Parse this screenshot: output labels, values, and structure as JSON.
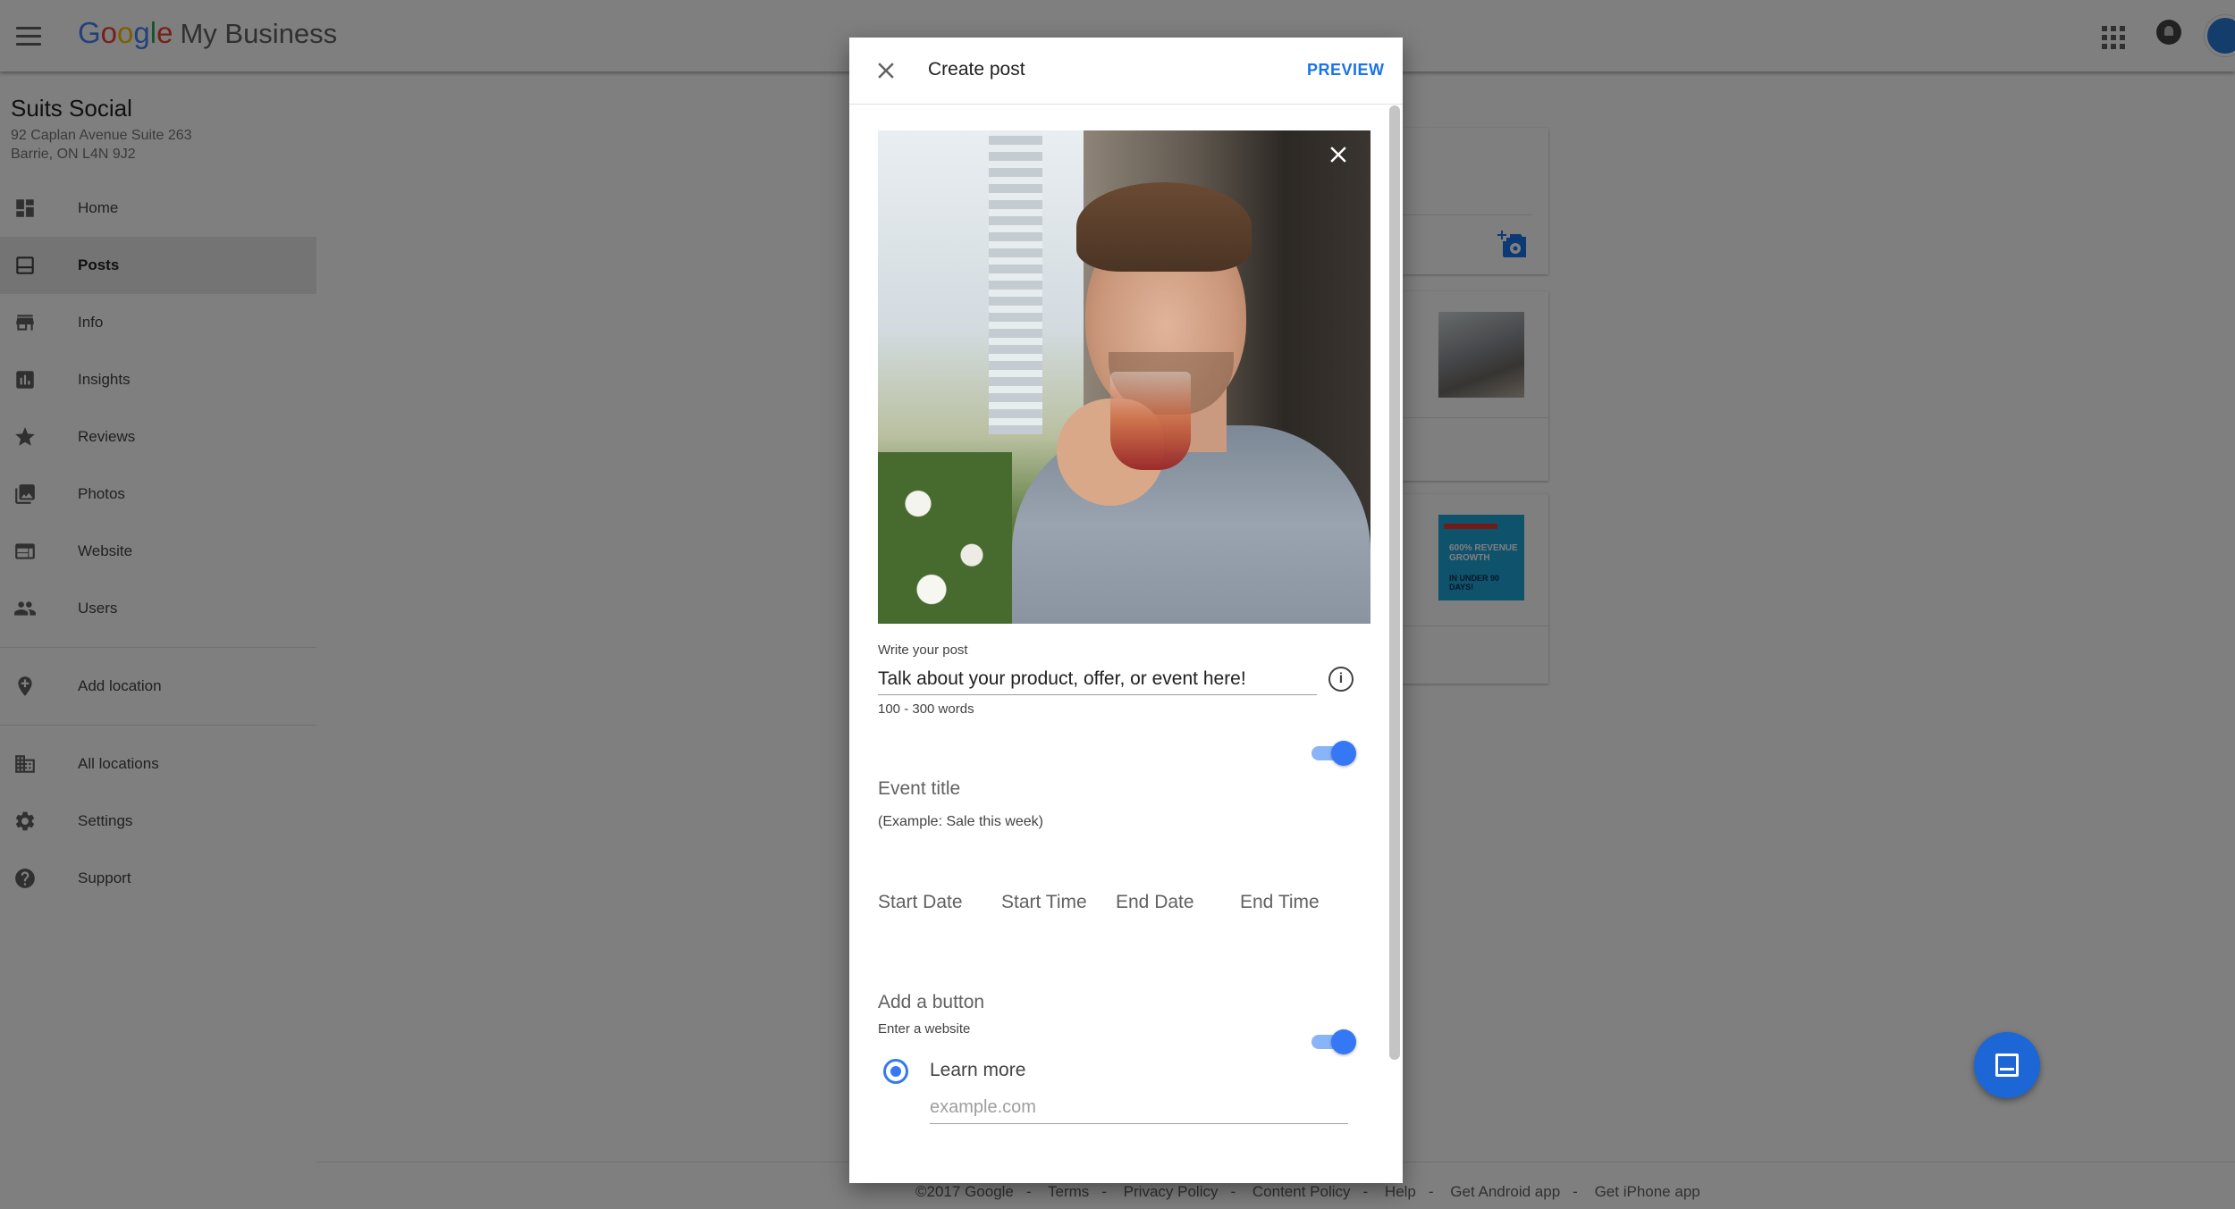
{
  "app": {
    "brand_google": "Google",
    "brand_product": "My Business"
  },
  "business": {
    "name": "Suits Social",
    "address_line1": "92 Caplan Avenue Suite 263",
    "address_line2": "Barrie, ON L4N 9J2"
  },
  "sidebar": {
    "items": [
      {
        "label": "Home",
        "icon": "dashboard-icon"
      },
      {
        "label": "Posts",
        "icon": "posts-icon",
        "active": true
      },
      {
        "label": "Info",
        "icon": "storefront-icon"
      },
      {
        "label": "Insights",
        "icon": "bar-chart-icon"
      },
      {
        "label": "Reviews",
        "icon": "star-icon"
      },
      {
        "label": "Photos",
        "icon": "photos-icon"
      },
      {
        "label": "Website",
        "icon": "website-icon"
      },
      {
        "label": "Users",
        "icon": "users-icon"
      },
      {
        "label": "Add location",
        "icon": "location-pin-icon"
      },
      {
        "label": "All locations",
        "icon": "building-icon"
      },
      {
        "label": "Settings",
        "icon": "gear-icon"
      },
      {
        "label": "Support",
        "icon": "help-icon"
      }
    ]
  },
  "preview_thumbnail": {
    "lines": [
      "600% REVENUE GROWTH",
      "IN UNDER 90 DAYS!"
    ]
  },
  "footer": {
    "links": [
      "©2017 Google",
      "Terms",
      "Privacy Policy",
      "Content Policy",
      "Help",
      "Get Android app",
      "Get iPhone app"
    ],
    "separator": "-"
  },
  "dialog": {
    "title": "Create post",
    "preview_label": "PREVIEW",
    "write_label": "Write your post",
    "post_text": "Talk about your product, offer, or event here!",
    "info_glyph": "i",
    "word_hint": "100 - 300 words",
    "event_toggle_on": true,
    "event_title_label": "Event title",
    "event_example": "(Example: Sale this week)",
    "date_fields": [
      "Start Date",
      "Start Time",
      "End Date",
      "End Time"
    ],
    "add_button_label": "Add a button",
    "add_button_toggle_on": true,
    "enter_website": "Enter a website",
    "button_option": "Learn more",
    "url_placeholder": "example.com"
  },
  "colors": {
    "accent": "#1a73e8",
    "toggle_on": "#3478f6",
    "fab": "#1c66d6"
  }
}
